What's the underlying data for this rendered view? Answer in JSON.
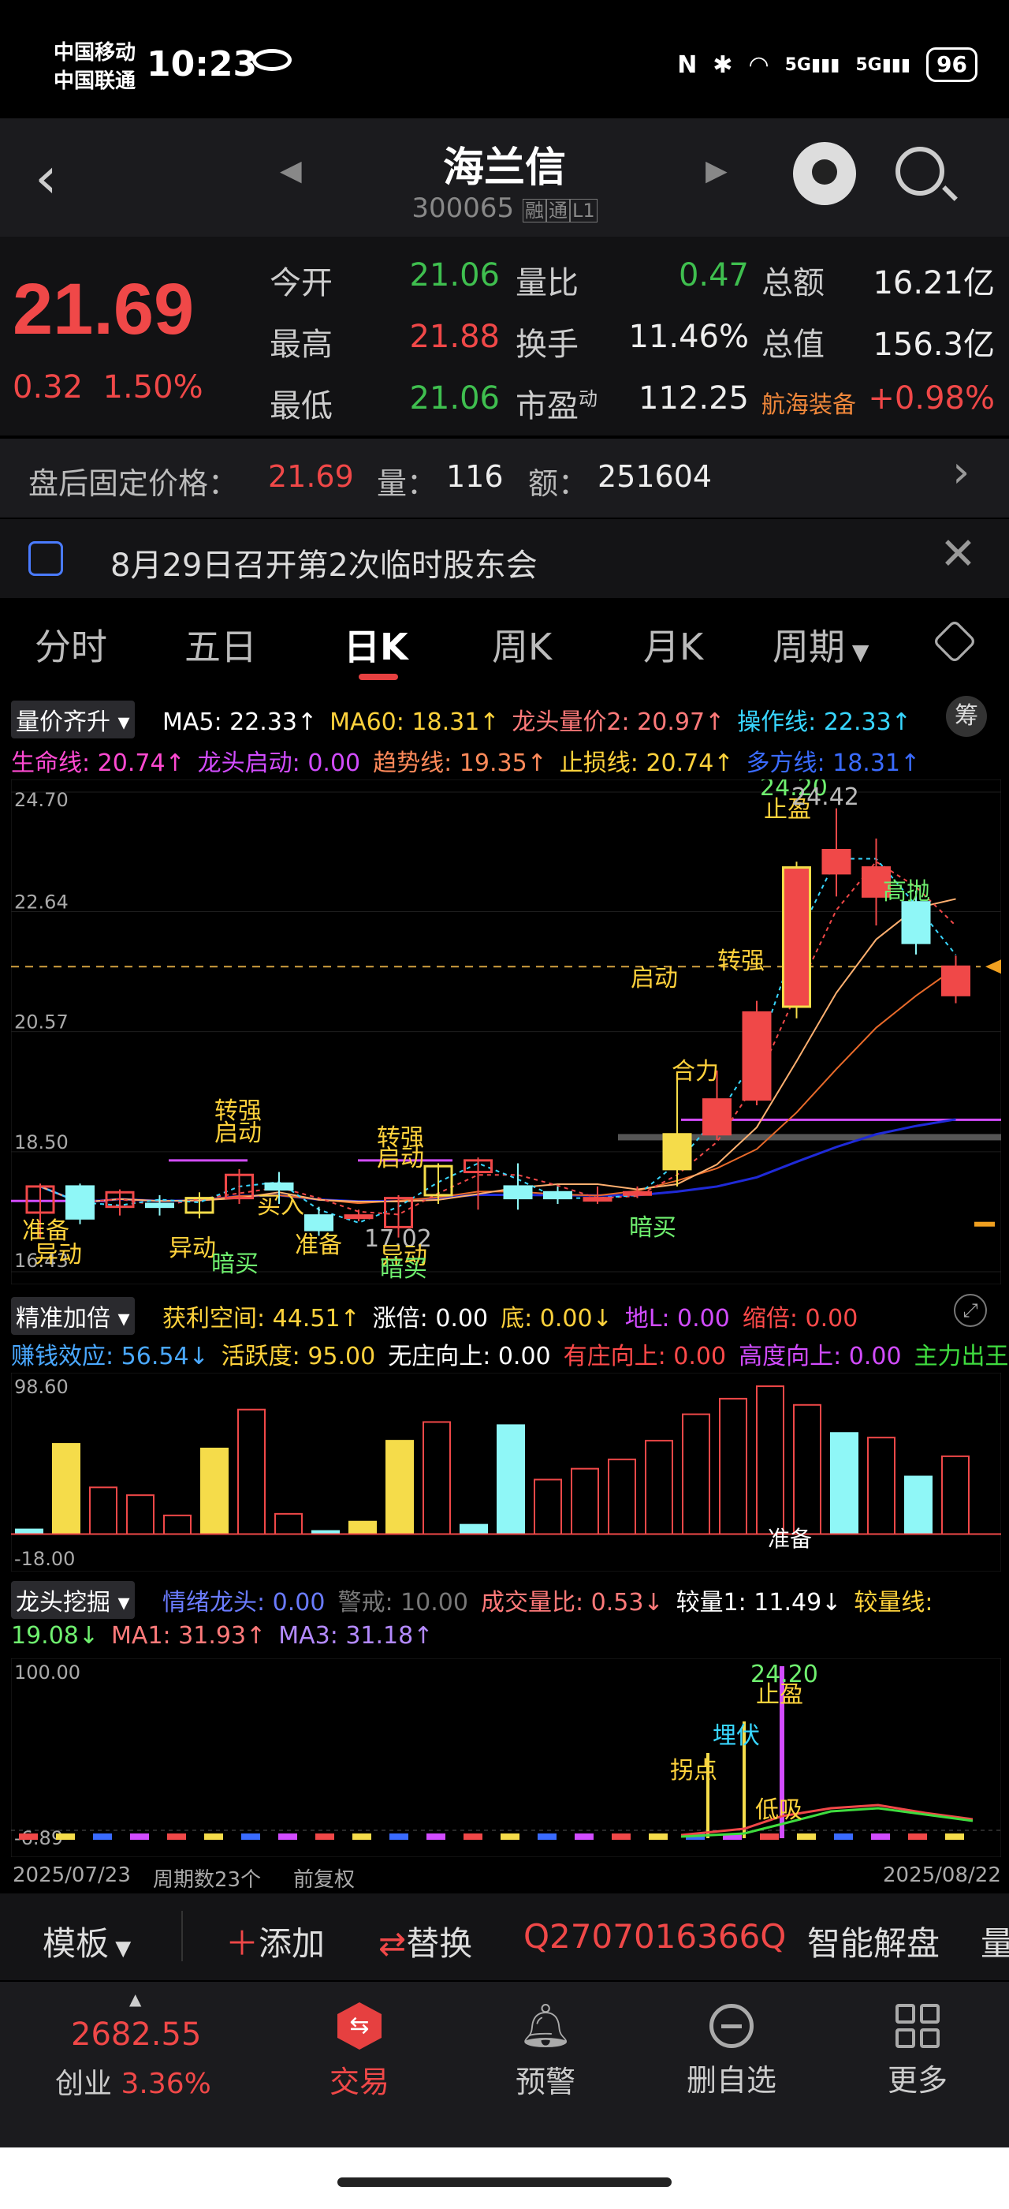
{
  "status": {
    "carrier1": "中国移动",
    "carrier2": "中国联通",
    "time": "10:23",
    "nfc": "N",
    "bt": "✱",
    "wifi": "◠",
    "sig1": "5G",
    "sig2": "5G",
    "battery": "96"
  },
  "header": {
    "title": "海兰信",
    "code": "300065",
    "tag1": "融",
    "tag2": "通",
    "tag3": "L1"
  },
  "quote": {
    "price": "21.69",
    "change": "0.32",
    "change_pct": "1.50%",
    "rows": [
      {
        "l1": "今开",
        "v1": "21.06",
        "l2": "量比",
        "v2": "0.47",
        "l3": "总额",
        "v3": "16.21亿"
      },
      {
        "l1": "最高",
        "v1": "21.88",
        "l2": "换手",
        "v2": "11.46%",
        "l3": "总值",
        "v3": "156.3亿"
      },
      {
        "l1": "最低",
        "v1": "21.06",
        "l2": "市盈",
        "l2sup": "动",
        "v2": "112.25",
        "l3": "航海装备",
        "v3": "+0.98%"
      }
    ]
  },
  "afterhours": {
    "label": "盘后固定价格：",
    "price": "21.69",
    "vol_label": "量：",
    "vol": "116",
    "amt_label": "额：",
    "amt": "251604"
  },
  "notice": {
    "text": "8月29日召开第2次临时股东会"
  },
  "tabs": [
    "分时",
    "五日",
    "日K",
    "周K",
    "月K",
    "周期"
  ],
  "main_ind": {
    "selector": "量价齐升",
    "line1": [
      {
        "t": "MA5: 22.33↑",
        "c": "#ffffff"
      },
      {
        "t": "MA60: 18.31↑",
        "c": "#ffd23c"
      },
      {
        "t": "龙头量价2: 20.97↑",
        "c": "#ff7a7a"
      },
      {
        "t": "操作线: 22.33↑",
        "c": "#38d6ff"
      }
    ],
    "line2": [
      {
        "t": "生命线: 20.74↑",
        "c": "#ff4ad2"
      },
      {
        "t": "龙头启动: 0.00",
        "c": "#d24cff"
      },
      {
        "t": "趋势线: 19.35↑",
        "c": "#ff8a5a"
      },
      {
        "t": "止损线: 20.74↑",
        "c": "#ffd23c"
      },
      {
        "t": "多方线: 18.31↑",
        "c": "#3a6bff"
      }
    ],
    "chou": "筹"
  },
  "kchart": {
    "y_labels": [
      "24.70",
      "22.64",
      "20.57",
      "18.50",
      "16.43"
    ],
    "dash_price": "21.69",
    "annotations": [
      {
        "t": "24.20",
        "c": "#6ff06f"
      },
      {
        "t": "止盈",
        "c": "#ffd23c"
      },
      {
        "t": "24.42",
        "c": "#bbbbbb"
      },
      {
        "t": "高抛",
        "c": "#6ff06f"
      },
      {
        "t": "转强",
        "c": "#ffd23c"
      },
      {
        "t": "启动",
        "c": "#ffd23c"
      },
      {
        "t": "合力",
        "c": "#ffd23c"
      },
      {
        "t": "转强",
        "c": "#ffd23c"
      },
      {
        "t": "启动",
        "c": "#ffd23c"
      },
      {
        "t": "转强",
        "c": "#ffd23c"
      },
      {
        "t": "启动",
        "c": "#ffd23c"
      },
      {
        "t": "买入",
        "c": "#ffd23c"
      },
      {
        "t": "准备",
        "c": "#ffd23c"
      },
      {
        "t": "异动",
        "c": "#ffd23c"
      },
      {
        "t": "异动",
        "c": "#ffd23c"
      },
      {
        "t": "暗买",
        "c": "#6ff06f"
      },
      {
        "t": "准备",
        "c": "#ffd23c"
      },
      {
        "t": "17.02",
        "c": "#bbbbbb"
      },
      {
        "t": "异动",
        "c": "#ffd23c"
      },
      {
        "t": "暗买",
        "c": "#6ff06f"
      },
      {
        "t": "暗买",
        "c": "#6ff06f"
      }
    ]
  },
  "ind2": {
    "selector": "精准加倍",
    "line1": [
      {
        "t": "获利空间: 44.51↑",
        "c": "#ffd23c"
      },
      {
        "t": "涨倍: 0.00",
        "c": "#ffffff"
      },
      {
        "t": "底: 0.00↓",
        "c": "#ffd23c"
      },
      {
        "t": "地L: 0.00",
        "c": "#d24cff"
      },
      {
        "t": "缩倍: 0.00",
        "c": "#ff4a4a"
      }
    ],
    "line2": [
      {
        "t": "赚钱效应: 56.54↓",
        "c": "#4aa8ff"
      },
      {
        "t": "活跃度: 95.00",
        "c": "#ffd23c"
      },
      {
        "t": "无庄向上: 0.00",
        "c": "#ffffff"
      },
      {
        "t": "有庄向上: 0.00",
        "c": "#ff4a4a"
      },
      {
        "t": "高度向上: 0.00",
        "c": "#d24cff"
      },
      {
        "t": "主力出王",
        "c": "#3fdc3f"
      }
    ],
    "ymax": "98.60",
    "ymin": "-18.00",
    "mark": "准备"
  },
  "ind3": {
    "selector": "龙头挖掘",
    "line1": [
      {
        "t": "情绪龙头: 0.00",
        "c": "#6a7bff"
      },
      {
        "t": "警戒: 10.00",
        "c": "#777777"
      },
      {
        "t": "成交量比: 0.53↓",
        "c": "#ff7a7a"
      },
      {
        "t": "较量1: 11.49↓",
        "c": "#ffffff"
      },
      {
        "t": "较量线:",
        "c": "#ffd23c"
      }
    ],
    "line2": [
      {
        "t": "19.08↓",
        "c": "#6ff06f"
      },
      {
        "t": "MA1: 31.93↑",
        "c": "#ff7a7a"
      },
      {
        "t": "MA3: 31.18↑",
        "c": "#b48aff"
      }
    ],
    "ymax": "100.00",
    "ymin": "-6.89",
    "marks": [
      "24.20",
      "止盈",
      "埋伏",
      "拐点",
      "低吸"
    ]
  },
  "xaxis": {
    "start": "2025/07/23",
    "period": "周期数23个",
    "adj": "前复权",
    "end": "2025/08/22"
  },
  "toolbar": {
    "template": "模板",
    "add": "添加",
    "replace": "替换",
    "code": "Q2707016366Q",
    "smart": "智能解盘",
    "more": "量"
  },
  "nav": {
    "index_val": "2682.55",
    "index_name": "创业",
    "index_pct": "3.36%",
    "items": [
      "交易",
      "预警",
      "删自选",
      "更多"
    ]
  },
  "colors": {
    "up": "#f04848",
    "down": "#3fbf4f",
    "bg": "#000000",
    "cyan": "#8ff7f7",
    "yellow": "#f5dc4a"
  },
  "ohlc": [
    [
      17.45,
      17.9,
      17.0,
      17.95
    ],
    [
      17.9,
      17.35,
      17.25,
      17.95
    ],
    [
      17.55,
      17.8,
      17.4,
      17.85
    ],
    [
      17.6,
      17.55,
      17.4,
      17.75
    ],
    [
      17.45,
      17.7,
      17.35,
      17.8
    ],
    [
      17.7,
      18.1,
      17.6,
      18.2
    ],
    [
      17.95,
      17.85,
      17.6,
      18.15
    ],
    [
      17.4,
      17.15,
      17.05,
      17.55
    ],
    [
      17.4,
      17.4,
      17.3,
      17.5
    ],
    [
      17.2,
      17.7,
      17.02,
      17.75
    ],
    [
      17.75,
      18.25,
      17.6,
      18.3
    ],
    [
      18.15,
      18.35,
      17.5,
      18.4
    ],
    [
      17.9,
      17.7,
      17.5,
      18.3
    ],
    [
      17.8,
      17.7,
      17.6,
      17.9
    ],
    [
      17.7,
      17.7,
      17.6,
      17.9
    ],
    [
      17.8,
      17.8,
      17.7,
      17.9
    ],
    [
      18.2,
      18.8,
      17.9,
      19.8
    ],
    [
      18.8,
      19.4,
      18.7,
      19.9
    ],
    [
      19.4,
      20.9,
      19.3,
      21.1
    ],
    [
      21.0,
      23.4,
      20.8,
      23.5
    ],
    [
      23.3,
      23.7,
      22.9,
      24.42
    ],
    [
      22.9,
      23.4,
      22.4,
      23.9
    ],
    [
      22.8,
      22.1,
      21.9,
      23.0
    ],
    [
      21.2,
      21.69,
      21.06,
      21.88
    ]
  ]
}
